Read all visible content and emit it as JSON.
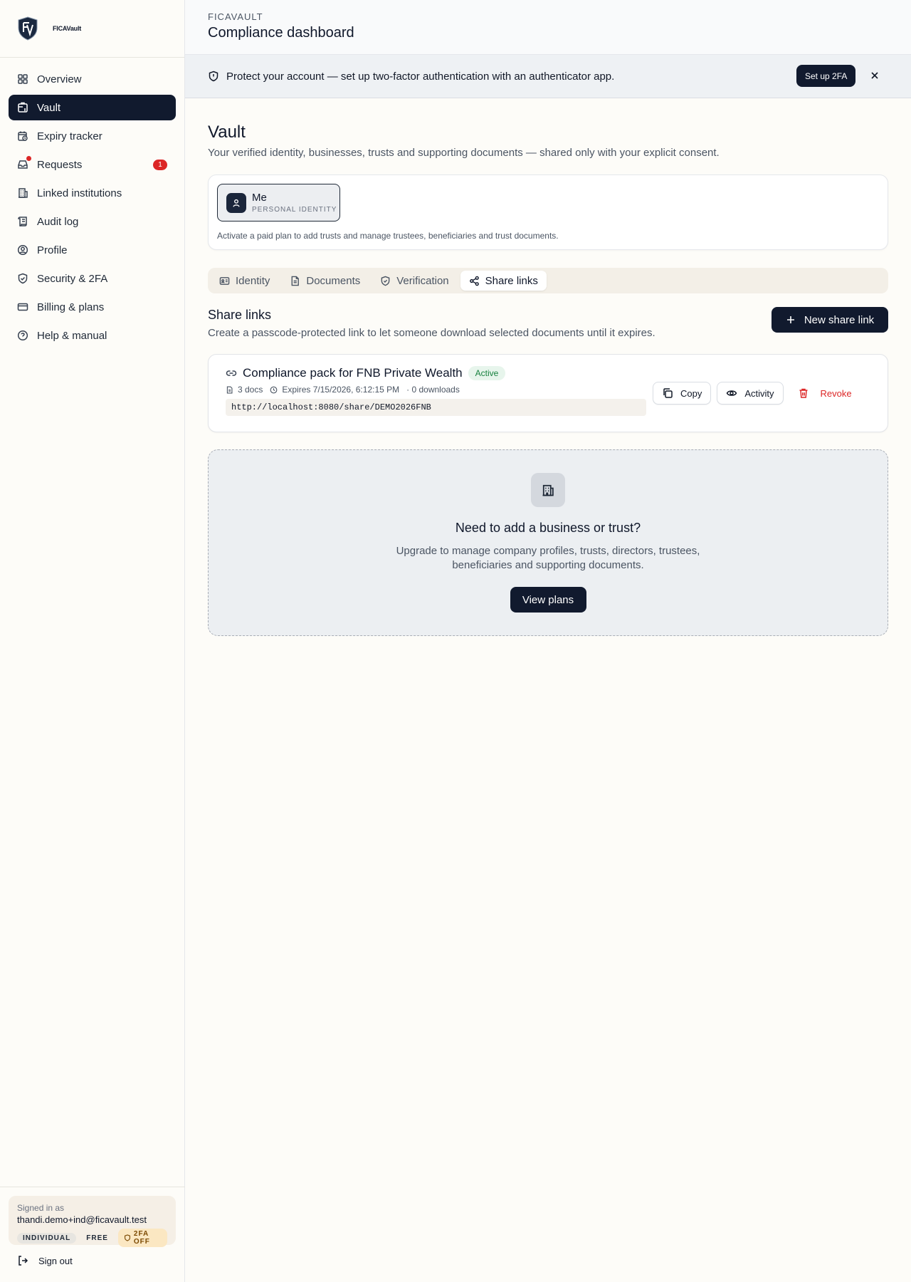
{
  "brand": {
    "name": "FICAVault"
  },
  "nav": [
    {
      "label": "Overview",
      "icon": "grid-icon",
      "active": false
    },
    {
      "label": "Vault",
      "icon": "vault-icon",
      "active": true
    },
    {
      "label": "Expiry tracker",
      "icon": "calendar-clock-icon",
      "active": false
    },
    {
      "label": "Requests",
      "icon": "inbox-icon",
      "active": false,
      "badge": "1"
    },
    {
      "label": "Linked institutions",
      "icon": "building-icon",
      "active": false
    },
    {
      "label": "Audit log",
      "icon": "scroll-icon",
      "active": false
    },
    {
      "label": "Profile",
      "icon": "user-circle-icon",
      "active": false
    },
    {
      "label": "Security & 2FA",
      "icon": "shield-check-icon",
      "active": false
    },
    {
      "label": "Billing & plans",
      "icon": "credit-card-icon",
      "active": false
    },
    {
      "label": "Help & manual",
      "icon": "help-circle-icon",
      "active": false
    }
  ],
  "account": {
    "signed_in_label": "Signed in as",
    "email": "thandi.demo+ind@ficavault.test",
    "chips": [
      "INDIVIDUAL",
      "FREE",
      "2FA OFF"
    ],
    "sign_out": "Sign out"
  },
  "header": {
    "kicker": "FICAVAULT",
    "title": "Compliance dashboard"
  },
  "banner": {
    "text": "Protect your account — set up two-factor authentication with an authenticator app.",
    "button": "Set up 2FA"
  },
  "page": {
    "title": "Vault",
    "subtitle": "Your verified identity, businesses, trusts and supporting documents — shared only with your explicit consent."
  },
  "entity": {
    "name": "Me",
    "kind": "PERSONAL IDENTITY",
    "note": "Activate a paid plan to add trusts and manage trustees, beneficiaries and trust documents."
  },
  "tabs": [
    {
      "label": "Identity",
      "icon": "id-card-icon",
      "active": false
    },
    {
      "label": "Documents",
      "icon": "document-icon",
      "active": false
    },
    {
      "label": "Verification",
      "icon": "shield-icon",
      "active": false
    },
    {
      "label": "Share links",
      "icon": "share-icon",
      "active": true
    }
  ],
  "share_links": {
    "title": "Share links",
    "subtitle": "Create a passcode-protected link to let someone download selected documents until it expires.",
    "new_button": "New share link",
    "items": [
      {
        "name": "Compliance pack for FNB Private Wealth",
        "status": "Active",
        "docs": "3 docs",
        "expires": "Expires 7/15/2026, 6:12:15 PM",
        "downloads": "· 0 downloads",
        "url": "http://localhost:8080/share/DEMO2026FNB",
        "actions": {
          "copy": "Copy",
          "activity": "Activity",
          "revoke": "Revoke"
        }
      }
    ]
  },
  "upsell": {
    "title": "Need to add a business or trust?",
    "subtitle": "Upgrade to manage company profiles, trusts, directors, trustees, beneficiaries and supporting documents.",
    "button": "View plans"
  },
  "colors": {
    "primary": "#111a2e",
    "danger": "#dc2626",
    "success": "#15803d"
  }
}
